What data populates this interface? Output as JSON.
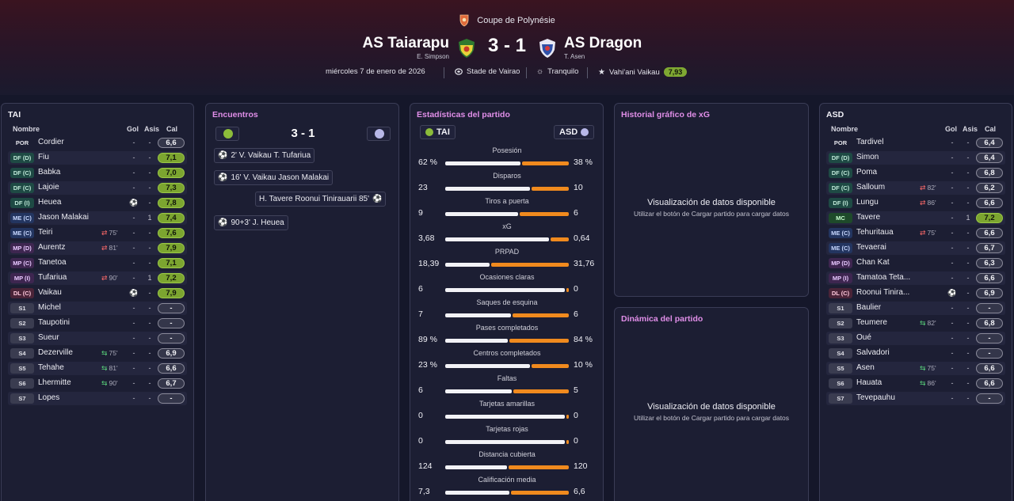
{
  "header": {
    "competition": "Coupe de Polynésie",
    "home_team": "AS Taiarapu",
    "home_manager": "E. Simpson",
    "away_team": "AS Dragon",
    "away_manager": "T. Asen",
    "score": "3 - 1",
    "date": "miércoles 7 de enero de 2026",
    "stadium": "Stade de Vairao",
    "weather": "Tranquilo",
    "potm_name": "Vahi'ani Vaikau",
    "potm_rating": "7,93"
  },
  "colors": {
    "accent_pink": "#e08ee8",
    "rating_green": "#7ca530",
    "bar_orange": "#f08a1e",
    "bar_white": "#f2f2f6"
  },
  "home_squad": {
    "title": "TAI",
    "col_name": "Nombre",
    "col_gol": "Gol",
    "col_asis": "Asis",
    "col_cal": "Cal",
    "players": [
      {
        "pos": "POR",
        "name": "Cordier",
        "sub": "",
        "gol": "-",
        "asis": "-",
        "cal": "6,6"
      },
      {
        "pos": "DF (D)",
        "name": "Fiu",
        "sub": "",
        "gol": "-",
        "asis": "-",
        "cal": "7,1"
      },
      {
        "pos": "DF (C)",
        "name": "Babka",
        "sub": "",
        "gol": "-",
        "asis": "-",
        "cal": "7,0"
      },
      {
        "pos": "DF (C)",
        "name": "Lajoie",
        "sub": "",
        "gol": "-",
        "asis": "-",
        "cal": "7,3"
      },
      {
        "pos": "DF (I)",
        "name": "Heuea",
        "sub": "",
        "gol": "",
        "asis": "-",
        "cal": "7,8"
      },
      {
        "pos": "ME (C)",
        "name": "Jason Malakai",
        "sub": "",
        "gol": "-",
        "asis": "1",
        "cal": "7,4"
      },
      {
        "pos": "ME (C)",
        "name": "Teiri",
        "sub": "75'",
        "gol": "-",
        "asis": "-",
        "cal": "7,6"
      },
      {
        "pos": "MP (D)",
        "name": "Aurentz",
        "sub": "81'",
        "gol": "-",
        "asis": "-",
        "cal": "7,9"
      },
      {
        "pos": "MP (C)",
        "name": "Tanetoa",
        "sub": "",
        "gol": "-",
        "asis": "-",
        "cal": "7,1"
      },
      {
        "pos": "MP (I)",
        "name": "Tufariua",
        "sub": "90'",
        "gol": "-",
        "asis": "1",
        "cal": "7,2"
      },
      {
        "pos": "DL (C)",
        "name": "Vaikau",
        "sub": "",
        "gol": "",
        "asis": "-",
        "cal": "7,9"
      },
      {
        "pos": "S1",
        "name": "Michel",
        "sub": "",
        "gol": "-",
        "asis": "-",
        "cal": "-"
      },
      {
        "pos": "S2",
        "name": "Taupotini",
        "sub": "",
        "gol": "-",
        "asis": "-",
        "cal": "-"
      },
      {
        "pos": "S3",
        "name": "Sueur",
        "sub": "",
        "gol": "-",
        "asis": "-",
        "cal": "-"
      },
      {
        "pos": "S4",
        "name": "Dezerville",
        "sub": "75'",
        "gol": "-",
        "asis": "-",
        "cal": "6,9"
      },
      {
        "pos": "S5",
        "name": "Tehahe",
        "sub": "81'",
        "gol": "-",
        "asis": "-",
        "cal": "6,6"
      },
      {
        "pos": "S6",
        "name": "Lhermitte",
        "sub": "90'",
        "gol": "-",
        "asis": "-",
        "cal": "6,7"
      },
      {
        "pos": "S7",
        "name": "Lopes",
        "sub": "",
        "gol": "-",
        "asis": "-",
        "cal": "-"
      }
    ]
  },
  "events": {
    "title": "Encuentros",
    "score": "3 - 1",
    "items": [
      {
        "text": "2'  V. Vaikau  T. Tufariua",
        "side": "home"
      },
      {
        "text": "16'  V. Vaikau  Jason Malakai",
        "side": "home"
      },
      {
        "text": "H. Tavere  Roonui Tinirauarii  85'",
        "side": "away"
      },
      {
        "text": "90+3'  J. Heuea",
        "side": "home"
      }
    ]
  },
  "stats": {
    "title": "Estadísticas del partido",
    "home_tag": "TAI",
    "away_tag": "ASD",
    "rows": [
      {
        "label": "Posesión",
        "home": "62 %",
        "away": "38 %",
        "h": 62,
        "a": 38
      },
      {
        "label": "Disparos",
        "home": "23",
        "away": "10",
        "h": 23,
        "a": 10
      },
      {
        "label": "Tiros a puerta",
        "home": "9",
        "away": "6",
        "h": 9,
        "a": 6
      },
      {
        "label": "xG",
        "home": "3,68",
        "away": "0,64",
        "h": 3.68,
        "a": 0.64
      },
      {
        "label": "PRPAD",
        "home": "18,39",
        "away": "31,76",
        "h": 18.39,
        "a": 31.76
      },
      {
        "label": "Ocasiones claras",
        "home": "6",
        "away": "0",
        "h": 6,
        "a": 0
      },
      {
        "label": "Saques de esquina",
        "home": "7",
        "away": "6",
        "h": 7,
        "a": 6
      },
      {
        "label": "Pases completados",
        "home": "89 %",
        "away": "84 %",
        "h": 89,
        "a": 84
      },
      {
        "label": "Centros completados",
        "home": "23 %",
        "away": "10 %",
        "h": 23,
        "a": 10
      },
      {
        "label": "Faltas",
        "home": "6",
        "away": "5",
        "h": 6,
        "a": 5
      },
      {
        "label": "Tarjetas amarillas",
        "home": "0",
        "away": "0",
        "h": 0,
        "a": 0
      },
      {
        "label": "Tarjetas rojas",
        "home": "0",
        "away": "0",
        "h": 0,
        "a": 0
      },
      {
        "label": "Distancia cubierta",
        "home": "124",
        "away": "120",
        "h": 124,
        "a": 120
      },
      {
        "label": "Calificación media",
        "home": "7,3",
        "away": "6,6",
        "h": 7.3,
        "a": 6.6
      }
    ]
  },
  "xg_chart": {
    "title": "Historial gráfico de xG",
    "message": "Visualización de datos disponible",
    "sub": "Utilizar el botón de Cargar partido para cargar datos"
  },
  "dynamics": {
    "title": "Dinámica del partido",
    "message": "Visualización de datos disponible",
    "sub": "Utilizar el botón de Cargar partido para cargar datos"
  },
  "away_squad": {
    "title": "ASD",
    "col_name": "Nombre",
    "col_gol": "Gol",
    "col_asis": "Asis",
    "col_cal": "Cal",
    "players": [
      {
        "pos": "POR",
        "name": "Tardivel",
        "sub": "",
        "gol": "-",
        "asis": "-",
        "cal": "6,4"
      },
      {
        "pos": "DF (D)",
        "name": "Simon",
        "sub": "",
        "gol": "-",
        "asis": "-",
        "cal": "6,4"
      },
      {
        "pos": "DF (C)",
        "name": "Poma",
        "sub": "",
        "gol": "-",
        "asis": "-",
        "cal": "6,8"
      },
      {
        "pos": "DF (C)",
        "name": "Salloum",
        "sub": "82'",
        "gol": "-",
        "asis": "-",
        "cal": "6,2"
      },
      {
        "pos": "DF (I)",
        "name": "Lungu",
        "sub": "86'",
        "gol": "-",
        "asis": "-",
        "cal": "6,6"
      },
      {
        "pos": "MC",
        "name": "Tavere",
        "sub": "",
        "gol": "-",
        "asis": "1",
        "cal": "7,2"
      },
      {
        "pos": "ME (C)",
        "name": "Tehuritaua",
        "sub": "75'",
        "gol": "-",
        "asis": "-",
        "cal": "6,6"
      },
      {
        "pos": "ME (C)",
        "name": "Tevaerai",
        "sub": "",
        "gol": "-",
        "asis": "-",
        "cal": "6,7"
      },
      {
        "pos": "MP (D)",
        "name": "Chan Kat",
        "sub": "",
        "gol": "-",
        "asis": "-",
        "cal": "6,3"
      },
      {
        "pos": "MP (I)",
        "name": "Tamatoa Teta...",
        "sub": "",
        "gol": "-",
        "asis": "-",
        "cal": "6,6"
      },
      {
        "pos": "DL (C)",
        "name": "Roonui Tinira...",
        "sub": "",
        "gol": "",
        "asis": "-",
        "cal": "6,9"
      },
      {
        "pos": "S1",
        "name": "Baulier",
        "sub": "",
        "gol": "-",
        "asis": "-",
        "cal": "-"
      },
      {
        "pos": "S2",
        "name": "Teumere",
        "sub": "82'",
        "gol": "-",
        "asis": "-",
        "cal": "6,8"
      },
      {
        "pos": "S3",
        "name": "Oué",
        "sub": "",
        "gol": "-",
        "asis": "-",
        "cal": "-"
      },
      {
        "pos": "S4",
        "name": "Salvadori",
        "sub": "",
        "gol": "-",
        "asis": "-",
        "cal": "-"
      },
      {
        "pos": "S5",
        "name": "Asen",
        "sub": "75'",
        "gol": "-",
        "asis": "-",
        "cal": "6,6"
      },
      {
        "pos": "S6",
        "name": "Hauata",
        "sub": "86'",
        "gol": "-",
        "asis": "-",
        "cal": "6,6"
      },
      {
        "pos": "S7",
        "name": "Tevepauhu",
        "sub": "",
        "gol": "-",
        "asis": "-",
        "cal": "-"
      }
    ]
  }
}
